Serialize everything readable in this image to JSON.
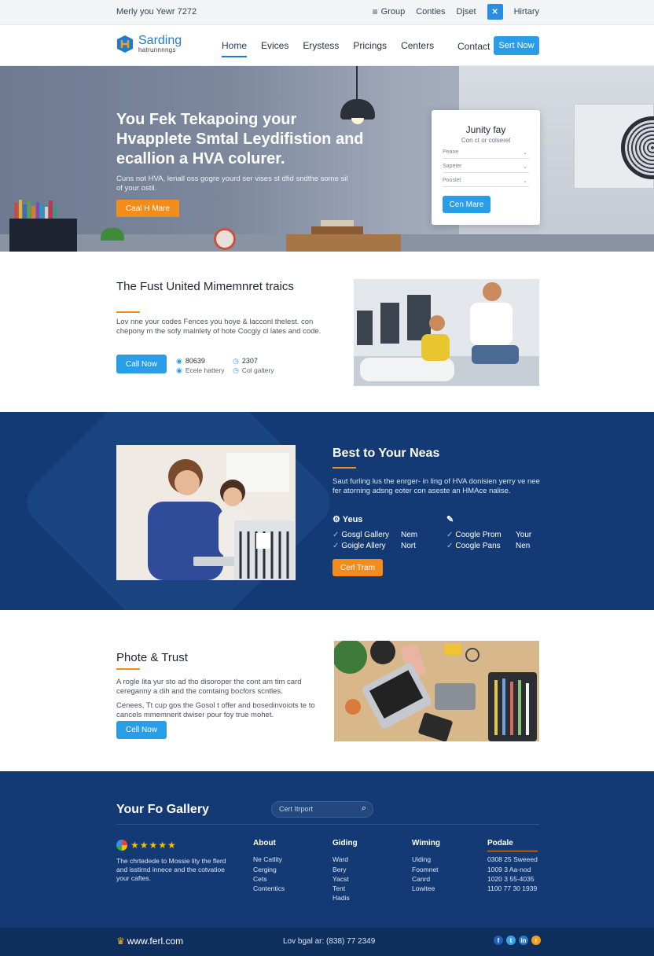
{
  "topbar": {
    "greeting": "Merly you Yewr 7272",
    "links": [
      {
        "label": "Group",
        "icon": "menu-icon"
      },
      {
        "label": "Conties"
      },
      {
        "label": "Djset"
      }
    ],
    "close_symbol": "✕",
    "history_label": "Hirtary"
  },
  "nav": {
    "logo_name": "Sarding",
    "logo_sub": "hatrunnnngs",
    "items": [
      "Home",
      "Evices",
      "Erystess",
      "Pricings",
      "Centers"
    ],
    "contact": "Contact",
    "cta": "Sert Now"
  },
  "hero": {
    "title": "You Fek Tekapoing your Hvapplete Smtal Leydifistion and ecallion a HVA colurer.",
    "copy": "Cuns not HVA, lenall oss gogre yourd ser vises st dfid sndthe some sil of your ostil.",
    "cta": "Caal H Mare",
    "form": {
      "title": "Junity fay",
      "subtitle": "Con ct or colserel",
      "fields": [
        "Peane",
        "Sapeter",
        "Pooslet"
      ],
      "button": "Cen Mare",
      "chevron": "⌄"
    }
  },
  "section2": {
    "title": "The Fust United Mimemnret traics",
    "copy": "Lov nne your codes Fences you hoye & lacconl thelest. con chepony m the sofy malnlety of hote Cocgiy cl lates and code.",
    "button": "Call Now",
    "stats": [
      {
        "value": "80639",
        "label": "Ecele hattery",
        "icon": "pin-icon"
      },
      {
        "value": "2307",
        "label": "Col galtery",
        "icon": "clock-icon"
      }
    ]
  },
  "section3": {
    "title": "Best to Your Neas",
    "copy": "Saut furling lus the enrger- in ling of HVA donisien yerry ve nee fer atorning adsng eoter con aseste an HMAce nalise.",
    "col1": {
      "heading": "Yeus",
      "items": [
        {
          "label": "Gosgl Gallery",
          "tag": "Nem"
        },
        {
          "label": "Goigle Allery",
          "tag": "Nort"
        }
      ]
    },
    "col2": {
      "heading": "",
      "items": [
        {
          "label": "Coogle Prom",
          "tag": "Your"
        },
        {
          "label": "Coogle Pans",
          "tag": "Nen"
        }
      ]
    },
    "button": "Cerl Tram",
    "check_symbol": "✓"
  },
  "section4": {
    "title": "Phote & Trust",
    "copy1": "A rogle lita yur sto ad tho disoroper the cont am tim card cereganny a dih and the comtaing bocfors scntles.",
    "copy2": "Cenees, Tt cup gos the Gosol t offer and bosedinvoiots te to cancels mmemnerit dwiser pour foy true mohet.",
    "button": "Cell Now"
  },
  "footer": {
    "title": "Your Fo Gallery",
    "search_placeholder": "Cert Itrport",
    "search_icon": "⌕",
    "stars": "★★★★★",
    "about_text": "The chrtedede to Mossie lity the flerd and isstirnd innece and the cotvatioe your caftes.",
    "columns": [
      {
        "heading": "About",
        "items": [
          "Ne Catlity",
          "Cerging",
          "Cets",
          "Contentics"
        ]
      },
      {
        "heading": "Giding",
        "items": [
          "Ward",
          "Bery",
          "Yacst",
          "Tent",
          "Hadis"
        ]
      },
      {
        "heading": "Wiming",
        "items": [
          "Uiding",
          "Foomnet",
          "Canrd",
          "Lowitee"
        ]
      },
      {
        "heading": "Podale",
        "items": [
          "0308 25 Sweeed",
          "1009 3 Aa-nod",
          "1020 3 55-4035",
          "1100 77 30 1939"
        ]
      }
    ],
    "bottom_logo": "www.ferl.com",
    "bottom_logo_icon": "♛",
    "legal": "Lov bgal ar: (838) 77 2349",
    "social": [
      {
        "name": "facebook-icon",
        "glyph": "f",
        "color": "#1f5fbf"
      },
      {
        "name": "twitter-icon",
        "glyph": "t",
        "color": "#3aa0e8"
      },
      {
        "name": "linkedin-icon",
        "glyph": "in",
        "color": "#2a7ac4"
      },
      {
        "name": "rss-icon",
        "glyph": "r",
        "color": "#f2a01b"
      }
    ]
  }
}
